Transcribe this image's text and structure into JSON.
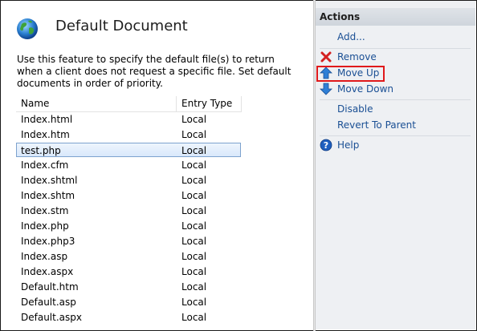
{
  "header": {
    "title": "Default Document",
    "icon": "globe-icon"
  },
  "description": "Use this feature to specify the default file(s) to return when a client does not request a specific file. Set default documents in order of priority.",
  "table": {
    "columns": [
      "Name",
      "Entry Type"
    ],
    "rows": [
      [
        "Index.html",
        "Local"
      ],
      [
        "Index.htm",
        "Local"
      ],
      [
        "test.php",
        "Local"
      ],
      [
        "Index.cfm",
        "Local"
      ],
      [
        "Index.shtml",
        "Local"
      ],
      [
        "Index.shtm",
        "Local"
      ],
      [
        "Index.stm",
        "Local"
      ],
      [
        "Index.php",
        "Local"
      ],
      [
        "Index.php3",
        "Local"
      ],
      [
        "Index.asp",
        "Local"
      ],
      [
        "Index.aspx",
        "Local"
      ],
      [
        "Default.htm",
        "Local"
      ],
      [
        "Default.asp",
        "Local"
      ],
      [
        "Default.aspx",
        "Local"
      ]
    ],
    "selected_row": 2
  },
  "actions": {
    "title": "Actions",
    "add": "Add...",
    "remove": "Remove",
    "move_up": "Move Up",
    "move_down": "Move Down",
    "disable": "Disable",
    "revert": "Revert To Parent",
    "help": "Help"
  },
  "colors": {
    "link": "#1a4f94",
    "highlight": "#e0191b",
    "selection": "#d9e8fb"
  }
}
